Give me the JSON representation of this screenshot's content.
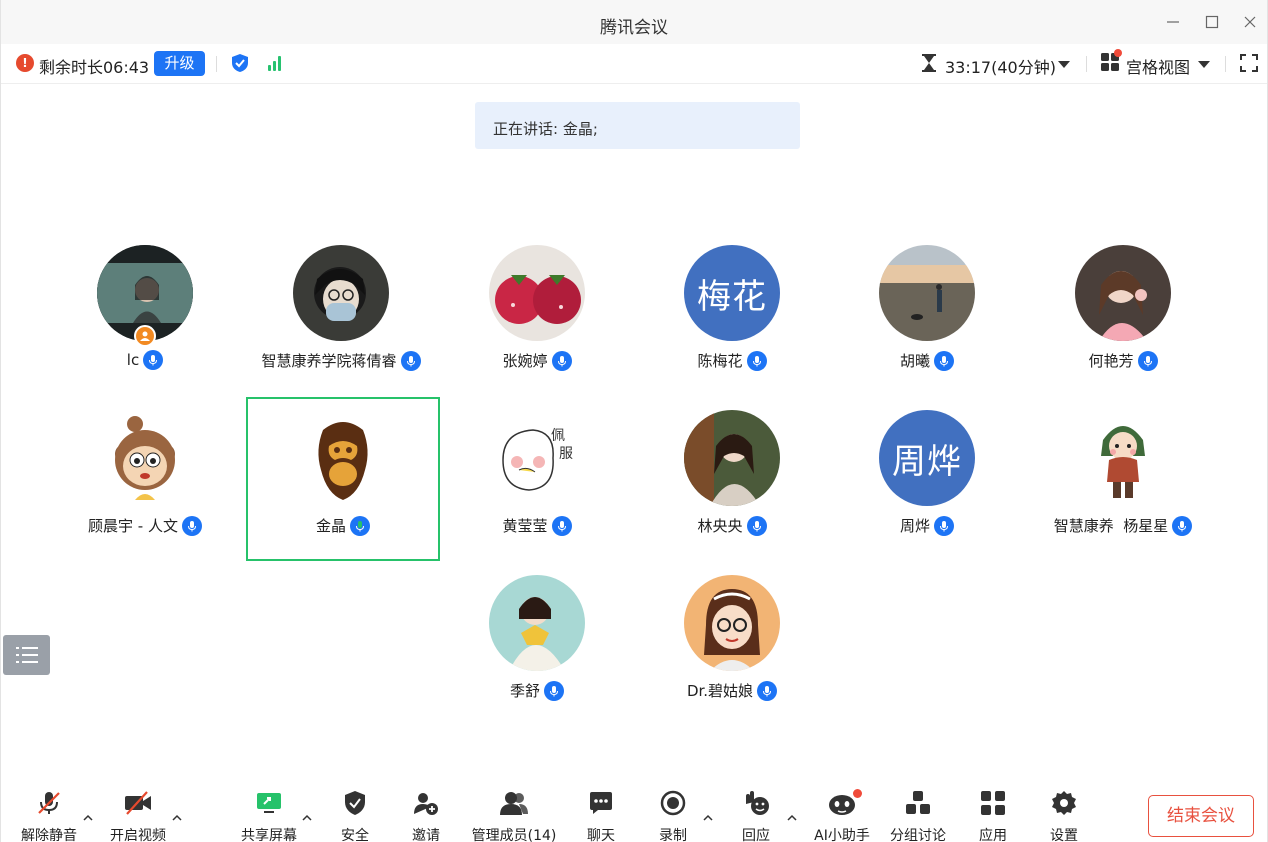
{
  "window": {
    "title": "腾讯会议"
  },
  "status": {
    "remaining": "剩余时长06:43",
    "upgrade_label": "升级",
    "timer": "33:17(40分钟)",
    "view_label": "宫格视图"
  },
  "speaking": "正在讲话: 金晶;",
  "participants": [
    {
      "name": "lc",
      "avatar_text": ""
    },
    {
      "name": "智慧康养学院蒋倩睿",
      "avatar_text": ""
    },
    {
      "name": "张婉婷",
      "avatar_text": ""
    },
    {
      "name": "陈梅花",
      "avatar_text": "梅花"
    },
    {
      "name": "胡曦",
      "avatar_text": ""
    },
    {
      "name": "何艳芳",
      "avatar_text": ""
    },
    {
      "name": "顾晨宇 - 人文",
      "avatar_text": ""
    },
    {
      "name": "金晶",
      "avatar_text": ""
    },
    {
      "name": "黄莹莹",
      "avatar_text": ""
    },
    {
      "name": "林央央",
      "avatar_text": ""
    },
    {
      "name": "周烨",
      "avatar_text": "周烨"
    },
    {
      "name": "智慧康养  杨星星",
      "avatar_text": ""
    },
    {
      "name": "季舒",
      "avatar_text": ""
    },
    {
      "name": "Dr.碧姑娘",
      "avatar_text": ""
    }
  ],
  "toolbar": {
    "unmute": "解除静音",
    "video": "开启视频",
    "share": "共享屏幕",
    "security": "安全",
    "invite": "邀请",
    "members": "管理成员(14)",
    "chat": "聊天",
    "record": "录制",
    "react": "回应",
    "ai": "AI小助手",
    "breakout": "分组讨论",
    "apps": "应用",
    "settings": "设置",
    "end": "结束会议"
  },
  "colors": {
    "accent": "#1d74f5",
    "active_border": "#26c26a",
    "end": "#e8513f",
    "avatar_blue": "#4170c0"
  },
  "icons": [
    "info-icon",
    "shield-icon",
    "signal-icon",
    "hourglass-icon",
    "grid-view-icon",
    "fullscreen-icon",
    "mic-icon",
    "host-icon",
    "list-icon",
    "mic-muted-icon",
    "video-off-icon",
    "share-screen-icon",
    "invite-icon",
    "members-icon",
    "chat-icon",
    "record-icon",
    "raise-hand-icon",
    "ai-assistant-icon",
    "breakout-icon",
    "apps-icon",
    "settings-icon"
  ]
}
